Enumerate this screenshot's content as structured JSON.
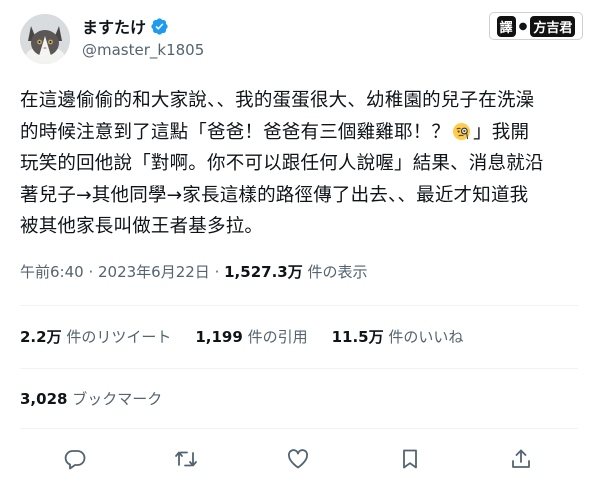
{
  "author": {
    "name": "ますたけ",
    "handle": "@master_k1805",
    "verified": true,
    "verified_color": "#1d9bf0"
  },
  "watermark": {
    "badge": "譯",
    "separator": "●",
    "name": "方吉君"
  },
  "tweet": {
    "lines": [
      "在這邊偷偷的和大家說、、我的蛋蛋很大、幼稚園的兒子在洗澡",
      "的時候注意到了這點「爸爸！爸爸有三個雞雞耶！？",
      "」我開",
      "玩笑的回他說「對啊。你不可以跟任何人說喔」結果、消息就沿",
      "著兒子→其他同學→家長這樣的路徑傳了出去、、最近才知道我",
      "被其他家長叫做王者基多拉。"
    ],
    "emoji": "face-with-monocle"
  },
  "meta": {
    "time": "午前6:40",
    "sep1": " · ",
    "date": "2023年6月22日",
    "sep2": " · ",
    "views": "1,527.3万",
    "views_label": " 件の表示"
  },
  "stats": {
    "retweets_count": "2.2万",
    "retweets_label": " 件のリツイート",
    "quotes_count": "1,199",
    "quotes_label": " 件の引用",
    "likes_count": "11.5万",
    "likes_label": " 件のいいね",
    "bookmarks_count": "3,028",
    "bookmarks_label": " ブックマーク"
  },
  "actions": [
    "reply-icon",
    "retweet-icon",
    "like-icon",
    "bookmark-icon",
    "share-icon"
  ],
  "colors": {
    "text": "#0f1419",
    "secondary": "#536471",
    "divider": "#eff3f4",
    "accent": "#1d9bf0"
  }
}
